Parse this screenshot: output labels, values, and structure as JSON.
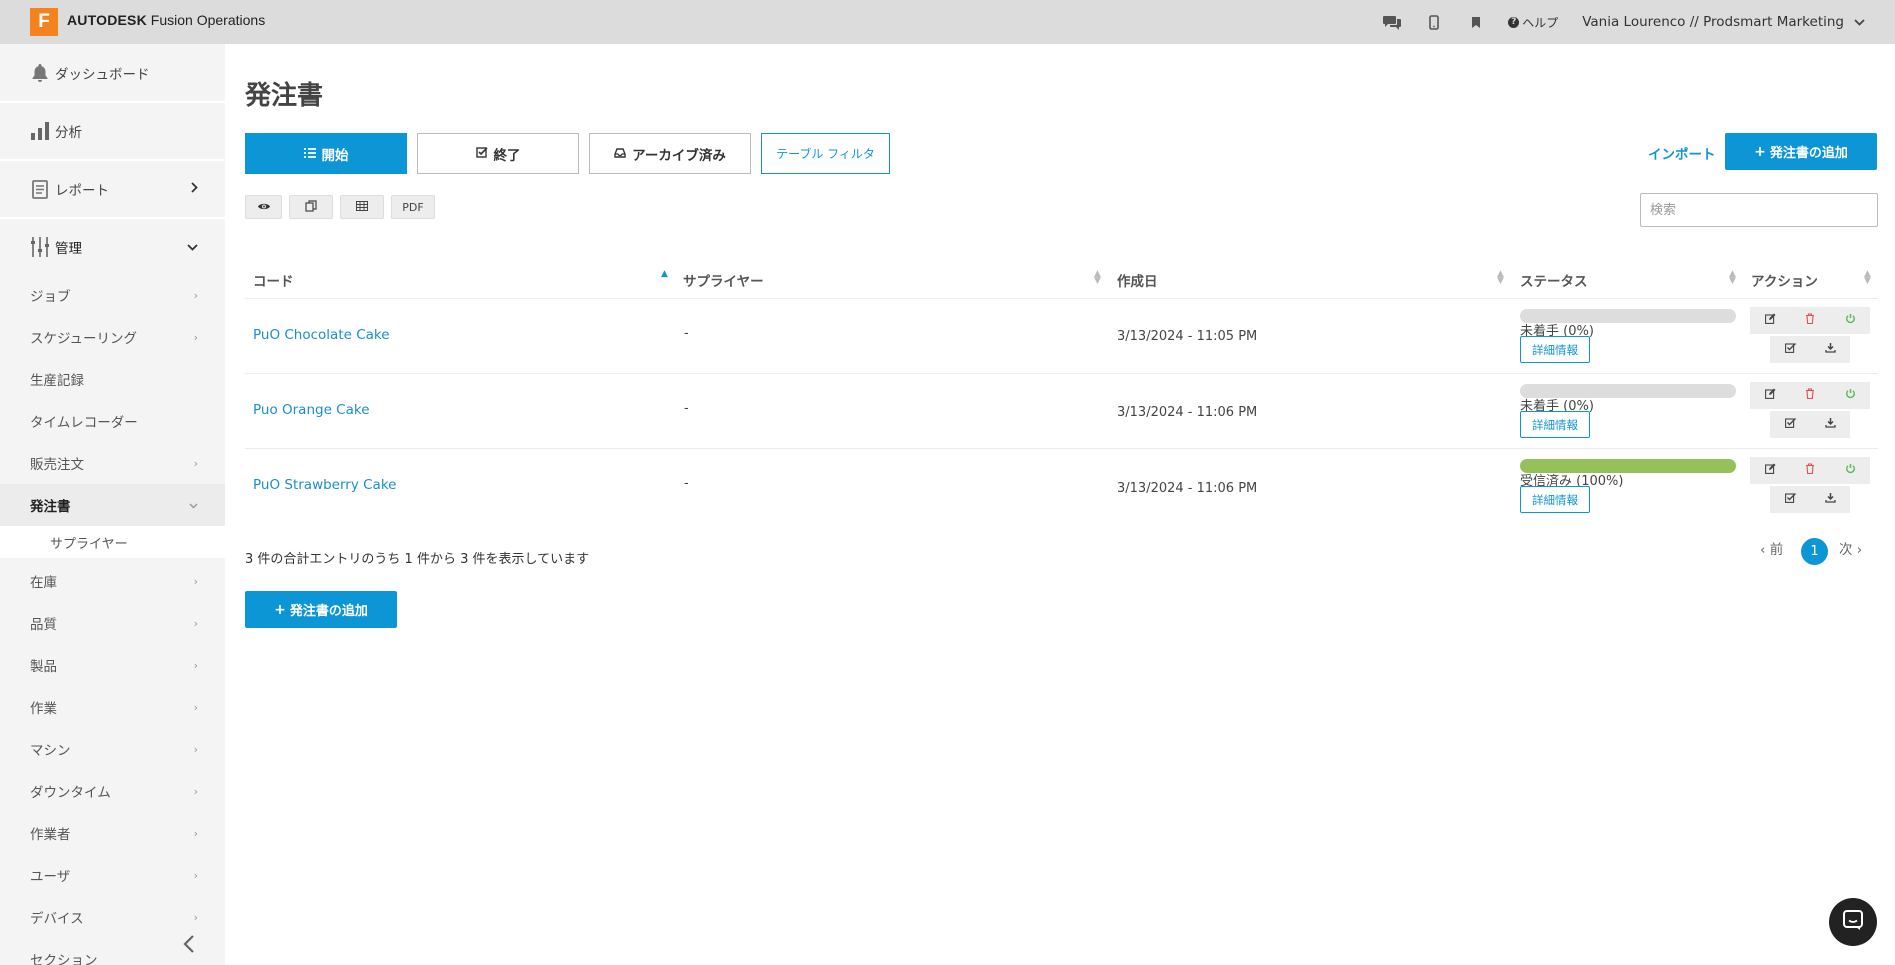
{
  "app": {
    "logo_letter": "F",
    "brand_bold": "AUTODESK",
    "brand_rest": "Fusion Operations",
    "help": "ヘルプ",
    "user": "Vania Lourenco // Prodsmart Marketing"
  },
  "sidebar": {
    "main": [
      {
        "label": "ダッシュボード",
        "icon": "bell-icon"
      },
      {
        "label": "分析",
        "icon": "bar-chart-icon"
      },
      {
        "label": "レポート",
        "icon": "report-icon"
      },
      {
        "label": "管理",
        "icon": "sliders-icon"
      }
    ],
    "sub": [
      {
        "label": "ジョブ"
      },
      {
        "label": "スケジューリング"
      },
      {
        "label": "生産記録"
      },
      {
        "label": "タイムレコーダー"
      },
      {
        "label": "販売注文"
      },
      {
        "label": "発注書"
      },
      {
        "label": "サプライヤー"
      },
      {
        "label": "在庫"
      },
      {
        "label": "品質"
      },
      {
        "label": "製品"
      },
      {
        "label": "作業"
      },
      {
        "label": "マシン"
      },
      {
        "label": "ダウンタイム"
      },
      {
        "label": "作業者"
      },
      {
        "label": "ユーザ"
      },
      {
        "label": "デバイス"
      },
      {
        "label": "セクション"
      }
    ]
  },
  "main": {
    "title": "発注書",
    "tabs": {
      "open": "開始",
      "closed": "終了",
      "archived": "アーカイブ済み",
      "filter": "テーブル フィルタ"
    },
    "import": "インポート",
    "add_top": "発注書の追加",
    "add_bottom": "発注書の追加",
    "tools": {
      "pdf": "PDF"
    },
    "search_placeholder": "検索"
  },
  "table": {
    "headers": {
      "code": "コード",
      "supplier": "サプライヤー",
      "created": "作成日",
      "status": "ステータス",
      "actions": "アクション"
    },
    "detail_label": "詳細情報",
    "rows": [
      {
        "code": "PuO Chocolate Cake",
        "supplier": "-",
        "created": "3/13/2024 - 11:05 PM",
        "status": "未着手 (0%)",
        "progress": 0
      },
      {
        "code": "Puo Orange Cake",
        "supplier": "-",
        "created": "3/13/2024 - 11:06 PM",
        "status": "未着手 (0%)",
        "progress": 0
      },
      {
        "code": "PuO Strawberry Cake",
        "supplier": "-",
        "created": "3/13/2024 - 11:06 PM",
        "status": "受信済み (100%)",
        "progress": 100
      }
    ],
    "info": "3 件の合計エントリのうち 1 件から 3 件を表示しています"
  },
  "pager": {
    "prev": "前",
    "page": "1",
    "next": "次"
  },
  "colors": {
    "accent": "#0d96d6",
    "progress": "#96c05a",
    "delete": "#e05050",
    "power": "#5cb85c"
  }
}
